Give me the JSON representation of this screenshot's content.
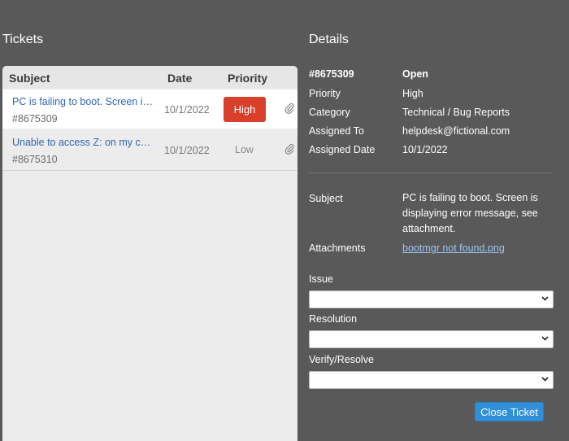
{
  "tickets_title": "Tickets",
  "details_title": "Details",
  "table": {
    "headers": {
      "subject": "Subject",
      "date": "Date",
      "priority": "Priority"
    },
    "rows": [
      {
        "subject": "PC is failing to boot. Screen is displaying error message, see attachment.",
        "number": "#8675309",
        "date": "10/1/2022",
        "priority": "High",
        "selected": true
      },
      {
        "subject": "Unable to access Z: on my computer",
        "number": "#8675310",
        "date": "10/1/2022",
        "priority": "Low",
        "selected": false
      }
    ]
  },
  "details": {
    "id": "#8675309",
    "status": "Open",
    "priority_label": "Priority",
    "priority": "High",
    "category_label": "Category",
    "category": "Technical / Bug Reports",
    "assigned_to_label": "Assigned To",
    "assigned_to": "helpdesk@fictional.com",
    "assigned_date_label": "Assigned Date",
    "assigned_date": "10/1/2022",
    "subject_label": "Subject",
    "subject": "PC is failing to boot. Screen is displaying error message, see attachment.",
    "attachments_label": "Attachments",
    "attachment": "bootmgr not found.png",
    "issue_label": "Issue",
    "issue_value": "",
    "resolution_label": "Resolution",
    "resolution_value": "",
    "verify_label": "Verify/Resolve",
    "verify_value": "",
    "close_button": "Close Ticket"
  },
  "colors": {
    "background": "#595959",
    "high_badge": "#d9402b",
    "link": "#2f66b3",
    "button": "#2f8fd9"
  },
  "icons": {
    "attachment": "paperclip-icon",
    "select": "chevron-down-icon"
  }
}
